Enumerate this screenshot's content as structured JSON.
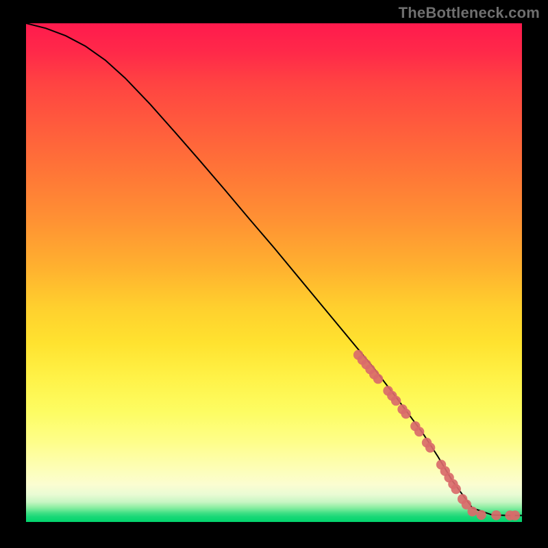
{
  "watermark": "TheBottleneck.com",
  "chart_data": {
    "type": "line",
    "title": "",
    "xlabel": "",
    "ylabel": "",
    "xlim": [
      0,
      100
    ],
    "ylim": [
      0,
      100
    ],
    "grid": false,
    "series": [
      {
        "name": "curve",
        "color": "#000000",
        "x": [
          0,
          4,
          8,
          12,
          16,
          20,
          25,
          30,
          35,
          40,
          45,
          50,
          55,
          60,
          65,
          70,
          75,
          80,
          83,
          86,
          90,
          94,
          97,
          100
        ],
        "y": [
          100,
          99,
          97.5,
          95.4,
          92.6,
          89,
          83.8,
          78.2,
          72.5,
          66.7,
          60.8,
          55,
          49,
          43,
          37,
          31,
          24.5,
          17.8,
          13.2,
          8.2,
          2.8,
          1.4,
          1.3,
          1.3
        ]
      }
    ],
    "markers": {
      "name": "highlight-points",
      "shape": "circle",
      "color": "#d96a6a",
      "radius_pct": 1.0,
      "x": [
        67,
        67.8,
        68.6,
        69.4,
        70.2,
        71,
        73,
        73.8,
        74.6,
        75.9,
        76.6,
        78.5,
        79.3,
        80.8,
        81.5,
        83.7,
        84.5,
        85.3,
        86.1,
        86.7,
        88,
        88.8,
        90,
        91.8,
        94.8,
        97.6,
        98.6
      ],
      "y": [
        33.5,
        32.5,
        31.6,
        30.6,
        29.6,
        28.7,
        26.3,
        25.3,
        24.3,
        22.6,
        21.7,
        19.2,
        18.1,
        15.9,
        14.9,
        11.5,
        10.2,
        8.9,
        7.6,
        6.6,
        4.6,
        3.5,
        2.1,
        1.4,
        1.35,
        1.3,
        1.3
      ]
    }
  },
  "gradient_stops": [
    {
      "pos": 0.0,
      "color": "#ff1a4d"
    },
    {
      "pos": 0.3,
      "color": "#ff7637"
    },
    {
      "pos": 0.57,
      "color": "#ffd02e"
    },
    {
      "pos": 0.78,
      "color": "#fdfd63"
    },
    {
      "pos": 0.925,
      "color": "#fbfdd1"
    },
    {
      "pos": 0.965,
      "color": "#8fefaa"
    },
    {
      "pos": 1.0,
      "color": "#01d46d"
    }
  ]
}
